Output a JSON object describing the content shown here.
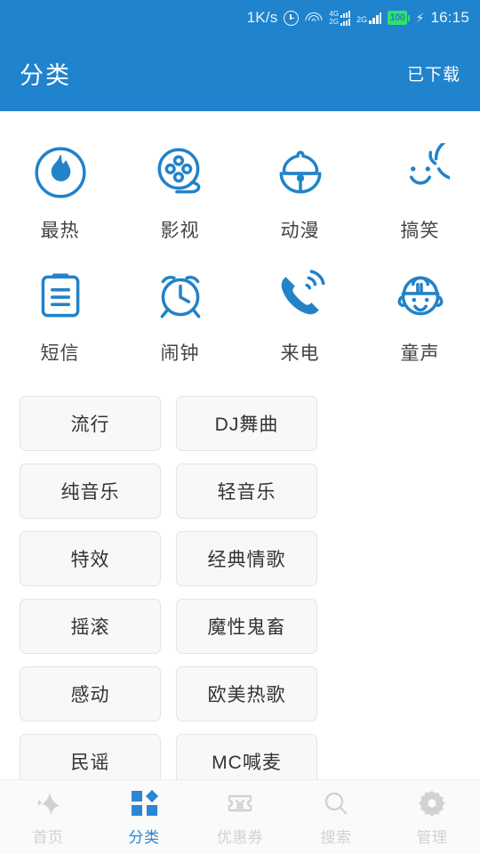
{
  "statusbar": {
    "network_speed": "1K/s",
    "alarm_icon": "alarm-clock-icon",
    "wifi_icon": "wifi-icon",
    "sim1_label_top": "4G",
    "sim1_label_bottom": "2G",
    "sim2_label": "2G",
    "battery_level": "100",
    "charging_icon": "bolt-icon",
    "time": "16:15"
  },
  "appbar": {
    "title": "分类",
    "action_label": "已下载"
  },
  "categories": [
    {
      "label": "最热",
      "icon": "flame-circle-icon"
    },
    {
      "label": "影视",
      "icon": "film-reel-icon"
    },
    {
      "label": "动漫",
      "icon": "doraemon-bell-icon"
    },
    {
      "label": "搞笑",
      "icon": "smiley-face-icon"
    },
    {
      "label": "短信",
      "icon": "message-clipboard-icon"
    },
    {
      "label": "闹钟",
      "icon": "alarm-clock-icon"
    },
    {
      "label": "来电",
      "icon": "ringing-phone-icon"
    },
    {
      "label": "童声",
      "icon": "child-face-icon"
    }
  ],
  "tags": [
    "流行",
    "DJ舞曲",
    "纯音乐",
    "轻音乐",
    "特效",
    "经典情歌",
    "摇滚",
    "魔性鬼畜",
    "感动",
    "欧美热歌",
    "民谣",
    "MC喊麦"
  ],
  "navbar": [
    {
      "label": "首页",
      "icon": "star-home-icon",
      "active": false
    },
    {
      "label": "分类",
      "icon": "grid-squares-icon",
      "active": true
    },
    {
      "label": "优惠券",
      "icon": "coupon-ticket-icon",
      "active": false
    },
    {
      "label": "搜索",
      "icon": "search-magnifier-icon",
      "active": false
    },
    {
      "label": "管理",
      "icon": "gear-icon",
      "active": false
    }
  ],
  "colors": {
    "brand_blue": "#1f83ce",
    "accent_blue": "#2b87d4",
    "icon_blue": "#2382c8",
    "nav_inactive": "#d2d2d2",
    "battery_green": "#31e06a"
  }
}
